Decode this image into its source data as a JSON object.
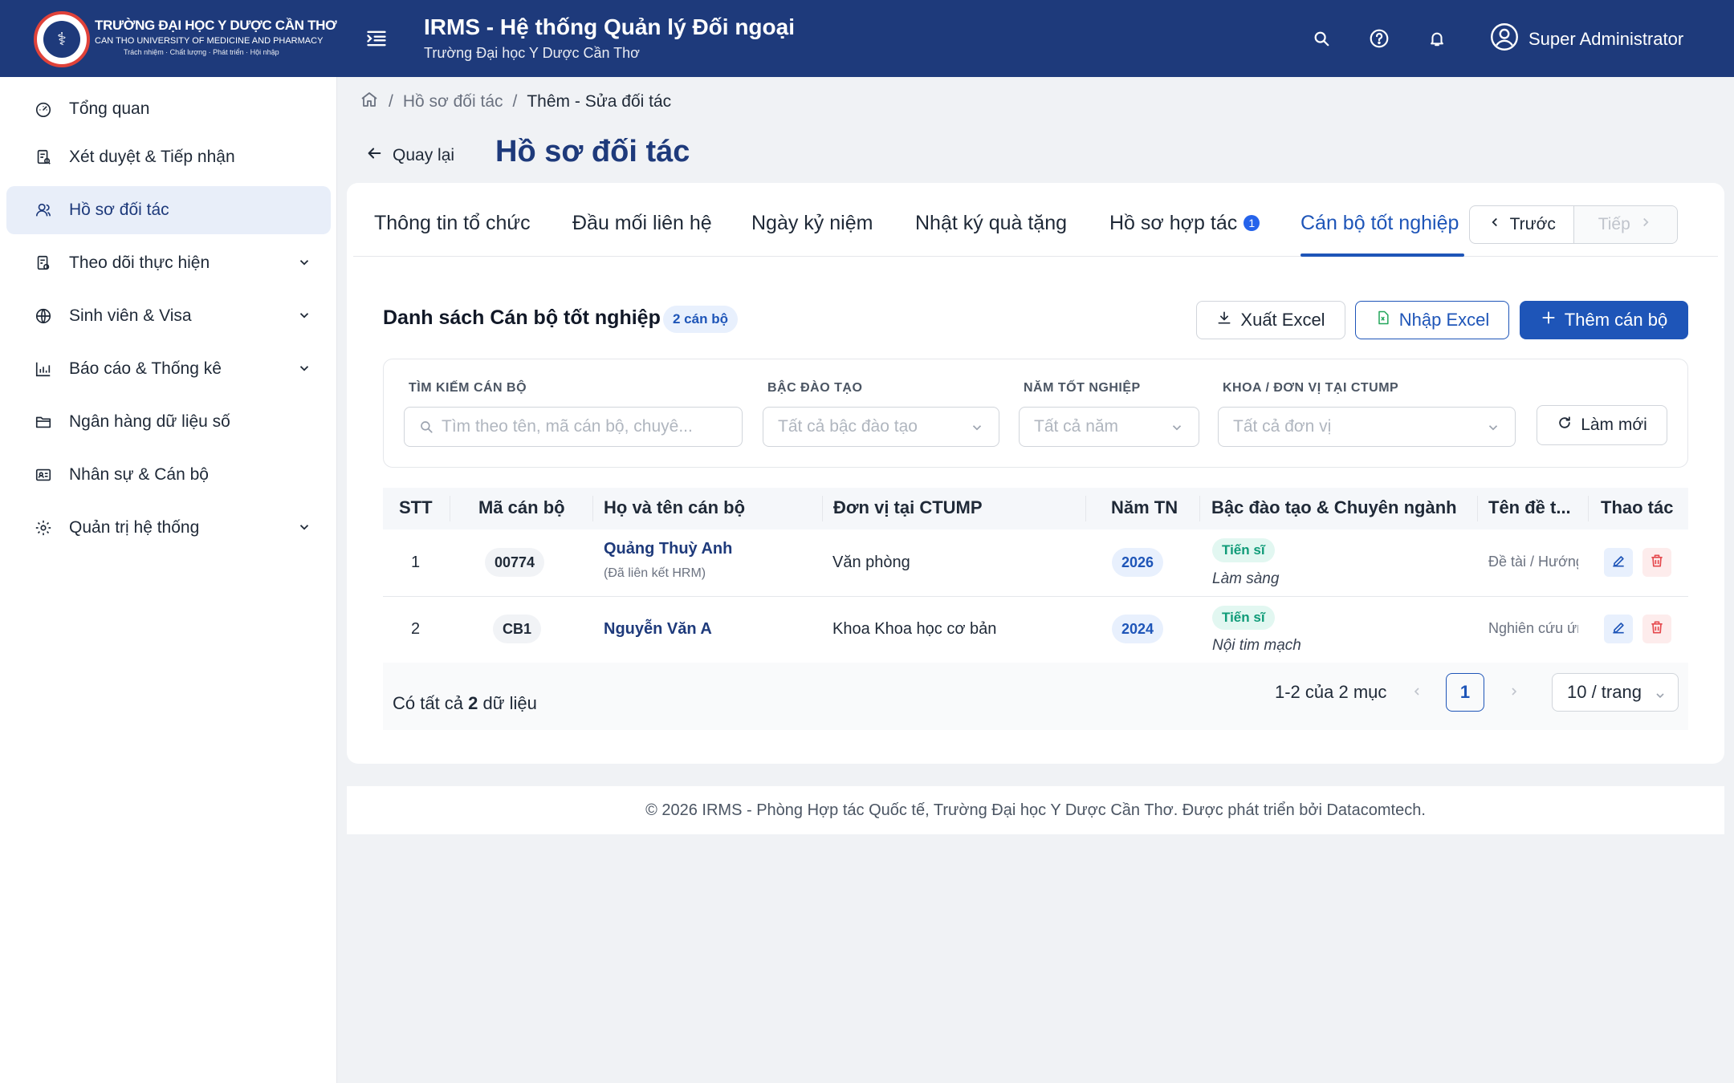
{
  "header": {
    "uni_name": "TRƯỜNG ĐẠI HỌC Y DƯỢC CẦN THƠ",
    "uni_en": "CAN THO UNIVERSITY OF MEDICINE AND PHARMACY",
    "uni_motto": "Trách nhiệm · Chất lượng · Phát triển · Hội nhập",
    "app_title": "IRMS - Hệ thống Quản lý Đối ngoại",
    "app_subtitle": "Trường Đại học Y Dược Cần Thơ",
    "user_name": "Super Administrator",
    "icons": [
      "menu-fold-icon",
      "search-icon",
      "question-icon",
      "bell-icon",
      "user-circle-icon"
    ]
  },
  "sidebar": {
    "items": [
      {
        "label": "Tổng quan",
        "icon": "dashboard-icon"
      },
      {
        "label": "Xét duyệt & Tiếp nhận",
        "icon": "audit-icon"
      },
      {
        "label": "Hồ sơ đối tác",
        "icon": "partner-icon",
        "active": true
      },
      {
        "label": "Theo dõi thực hiện",
        "icon": "tracking-icon",
        "expandable": true
      },
      {
        "label": "Sinh viên & Visa",
        "icon": "globe-icon",
        "expandable": true
      },
      {
        "label": "Báo cáo & Thống kê",
        "icon": "bar-chart-icon",
        "expandable": true
      },
      {
        "label": "Ngân hàng dữ liệu số",
        "icon": "folder-icon"
      },
      {
        "label": "Nhân sự & Cán bộ",
        "icon": "id-card-icon"
      },
      {
        "label": "Quản trị hệ thống",
        "icon": "gear-icon",
        "expandable": true
      }
    ]
  },
  "breadcrumb": {
    "sep": "/",
    "parent": "Hồ sơ đối tác",
    "current": "Thêm - Sửa đối tác"
  },
  "page": {
    "back_label": "Quay lại",
    "title": "Hồ sơ đối tác"
  },
  "tabs": [
    {
      "label": "Thông tin tổ chức"
    },
    {
      "label": "Đầu mối liên hệ"
    },
    {
      "label": "Ngày kỷ niệm"
    },
    {
      "label": "Nhật ký quà tặng"
    },
    {
      "label": "Hồ sơ hợp tác",
      "badge": "1"
    },
    {
      "label": "Cán bộ tốt nghiệp",
      "active": true
    }
  ],
  "tab_nav": {
    "prev": "Trước",
    "next": "Tiếp"
  },
  "list": {
    "title": "Danh sách Cán bộ tốt nghiệp",
    "count_badge": "2 cán bộ",
    "export_label": "Xuất Excel",
    "import_label": "Nhập Excel",
    "add_label": "Thêm cán bộ"
  },
  "filters": {
    "search_label": "TÌM KIẾM CÁN BỘ",
    "search_placeholder": "Tìm theo tên, mã cán bộ, chuyê...",
    "degree_label": "BẬC ĐÀO TẠO",
    "degree_value": "Tất cả bậc đào tạo",
    "year_label": "NĂM TỐT NGHIỆP",
    "year_value": "Tất cả năm",
    "unit_label": "KHOA / ĐƠN VỊ TẠI CTUMP",
    "unit_value": "Tất cả đơn vị",
    "reset_label": "Làm mới"
  },
  "table": {
    "columns": [
      "STT",
      "Mã cán bộ",
      "Họ và tên cán bộ",
      "Đơn vị tại CTUMP",
      "Năm TN",
      "Bậc đào tạo & Chuyên ngành",
      "Tên đề t...",
      "Thao tác"
    ],
    "rows": [
      {
        "stt": "1",
        "code": "00774",
        "name": "Quảng Thuỳ Anh",
        "name_note": "(Đã liên kết HRM)",
        "unit": "Văn phòng",
        "year": "2026",
        "degree": "Tiến sĩ",
        "major": "Làm sàng",
        "topic": "Đề tài / Hướng"
      },
      {
        "stt": "2",
        "code": "CB1",
        "name": "Nguyễn Văn A",
        "name_note": "",
        "unit": "Khoa Khoa học cơ bản",
        "year": "2024",
        "degree": "Tiến sĩ",
        "major": "Nội tim mạch",
        "topic": "Nghiên cứu ứng"
      }
    ]
  },
  "pagination": {
    "total_prefix": "Có tất cả ",
    "total_count": "2",
    "total_suffix": " dữ liệu",
    "range": "1-2 của 2 mục",
    "current_page": "1",
    "page_size": "10 / trang"
  },
  "footer": {
    "text": "© 2026 IRMS - Phòng Hợp tác Quốc tế, Trường Đại học Y Dược Cần Thơ. Được phát triển bởi Datacomtech."
  },
  "colors": {
    "header_bg": "#1e3a7b",
    "primary": "#1e55b8",
    "active_nav_bg": "#e8eef9",
    "degree_badge": "#0f9b78",
    "danger": "#e5484d"
  }
}
